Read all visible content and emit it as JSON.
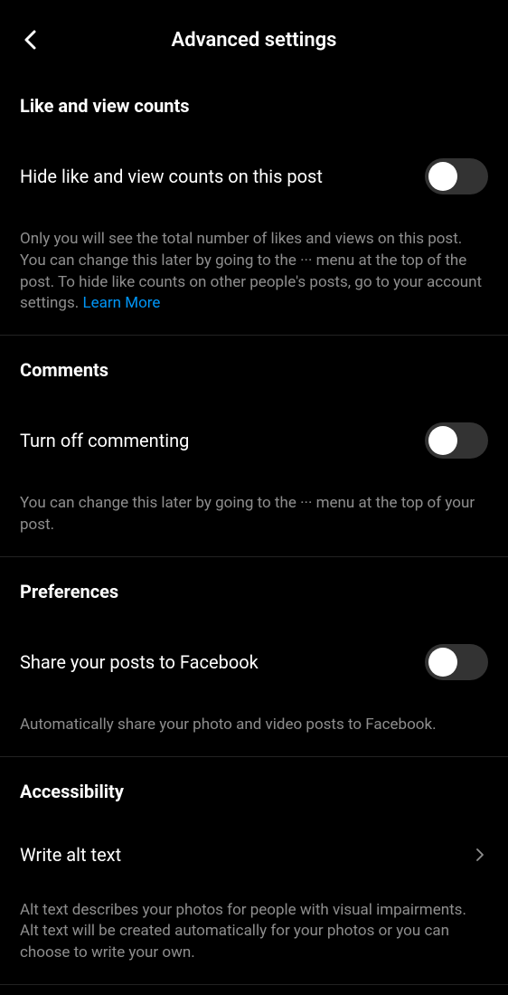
{
  "header": {
    "title": "Advanced settings"
  },
  "sections": {
    "likes": {
      "title": "Like and view counts",
      "toggle_label": "Hide like and view counts on this post",
      "description": "Only you will see the total number of likes and views on this post. You can change this later by going to the ··· menu at the top of the post. To hide like counts on other people's posts, go to your account settings. ",
      "learn_more": "Learn More"
    },
    "comments": {
      "title": "Comments",
      "toggle_label": "Turn off commenting",
      "description": "You can change this later by going to the ··· menu at the top of your post."
    },
    "preferences": {
      "title": "Preferences",
      "toggle_label": "Share your posts to Facebook",
      "description": "Automatically share your photo and video posts to Facebook."
    },
    "accessibility": {
      "title": "Accessibility",
      "nav_label": "Write alt text",
      "description": "Alt text describes your photos for people with visual impairments. Alt text will be created automatically for your photos or you can choose to write your own."
    }
  }
}
